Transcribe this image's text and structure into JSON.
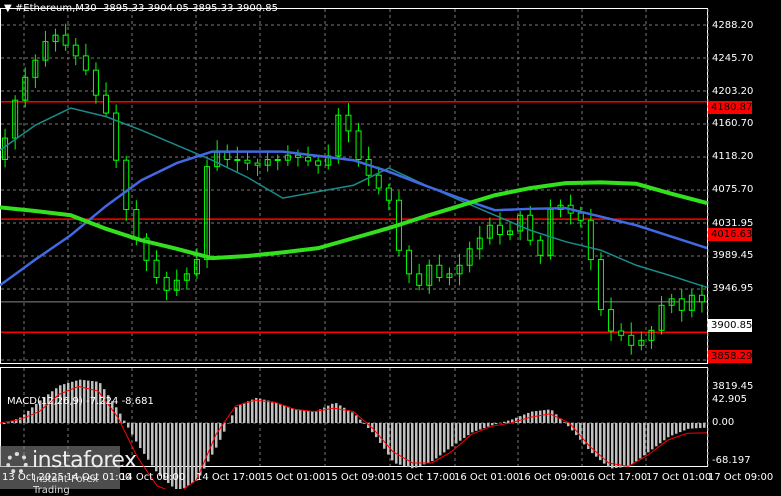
{
  "header": {
    "symbol": "#Ethereum,M30",
    "open": "3895.33",
    "high": "3904.05",
    "low": "3895.33",
    "close": "3900.85"
  },
  "price_axis": [
    "4288.20",
    "4245.70",
    "4203.20",
    "4160.70",
    "4118.20",
    "4075.70",
    "4031.95",
    "3989.45",
    "3946.95",
    "3819.45"
  ],
  "levels": {
    "upper": "4180.87",
    "middle": "4016.63",
    "lower": "3858.29",
    "current": "3900.85"
  },
  "macd": {
    "label": "MACD(12,26,9)",
    "main": "-7.224",
    "signal": "-8.681",
    "axis": [
      "42.905",
      "0.00",
      "-68.197"
    ]
  },
  "time_axis": [
    "13 Oct 2025",
    "14 Oct 01:00",
    "14 Oct 09:00",
    "14 Oct 17:00",
    "15 Oct 01:00",
    "15 Oct 09:00",
    "15 Oct 17:00",
    "16 Oct 01:00",
    "16 Oct 09:00",
    "16 Oct 17:00",
    "17 Oct 01:00",
    "17 Oct 09:00"
  ],
  "watermark": {
    "name": "instaforex",
    "tagline": "Instant Forex Trading"
  },
  "colors": {
    "bull": "#00ff00",
    "level": "#ff0000",
    "ma_slow": "#32e01e",
    "ma_mid": "#4169e1",
    "ma_fast": "#1a8a8a",
    "hist": "#c0c0c0",
    "signal": "#ff0000"
  },
  "chart_data": {
    "type": "line",
    "closes": [
      4100,
      4130,
      4183,
      4215,
      4239,
      4265,
      4274,
      4260,
      4245,
      4225,
      4190,
      4165,
      4099,
      4030,
      3990,
      3959,
      3935,
      3917,
      3931,
      3940,
      3960,
      4090,
      4110,
      4100,
      4099,
      4095,
      4092,
      4100,
      4099,
      4106,
      4103,
      4098,
      4092,
      4105,
      4162,
      4140,
      4100,
      4078,
      4060,
      4043,
      3973,
      3940,
      3924,
      3952,
      3935,
      3940,
      3952,
      3975,
      3990,
      4008,
      3995,
      4000,
      4022,
      3987,
      3966,
      4030,
      4036,
      4025,
      4015,
      3960,
      3890,
      3860,
      3854,
      3840,
      3847,
      3861,
      3896,
      3905,
      3889,
      3910,
      3900.85
    ],
    "ma_slow": [
      4033,
      4028,
      4022,
      4003,
      3987,
      3975,
      3962,
      3965,
      3970,
      3976,
      3990,
      4004,
      4020,
      4035,
      4050,
      4060,
      4067,
      4068,
      4066,
      4052,
      4039
    ],
    "ma_mid": [
      3924,
      3960,
      3994,
      4035,
      4071,
      4095,
      4111,
      4111,
      4111,
      4105,
      4099,
      4083,
      4064,
      4046,
      4029,
      4031,
      4032,
      4020,
      4008,
      3992,
      3976
    ],
    "ma_fast": [
      4113,
      4148,
      4172,
      4160,
      4141,
      4120,
      4099,
      4075,
      4046,
      4055,
      4064,
      4088,
      4065,
      4043,
      4022,
      4001,
      3985,
      3973,
      3952,
      3937,
      3921
    ],
    "macd_hist": [
      -2,
      5,
      20,
      33,
      38,
      36,
      10,
      -20,
      -45,
      -60,
      -50,
      -20,
      15,
      22,
      18,
      12,
      10,
      18,
      8,
      -10,
      -35,
      -40,
      -33,
      -20,
      -8,
      -2,
      3,
      10,
      12,
      -5,
      -25,
      -40,
      -38,
      -25,
      -12,
      -5,
      -4
    ],
    "macd_signal": [
      0,
      3,
      10,
      25,
      32,
      28,
      5,
      -30,
      -55,
      -62,
      -50,
      -10,
      15,
      20,
      18,
      12,
      10,
      13,
      10,
      -5,
      -25,
      -35,
      -35,
      -25,
      -10,
      -3,
      0,
      5,
      8,
      0,
      -20,
      -35,
      -38,
      -28,
      -15,
      -9,
      -8.7
    ],
    "ylim": [
      3819.45,
      4288.2
    ],
    "macd_ylim": [
      -68.197,
      42.905
    ]
  }
}
